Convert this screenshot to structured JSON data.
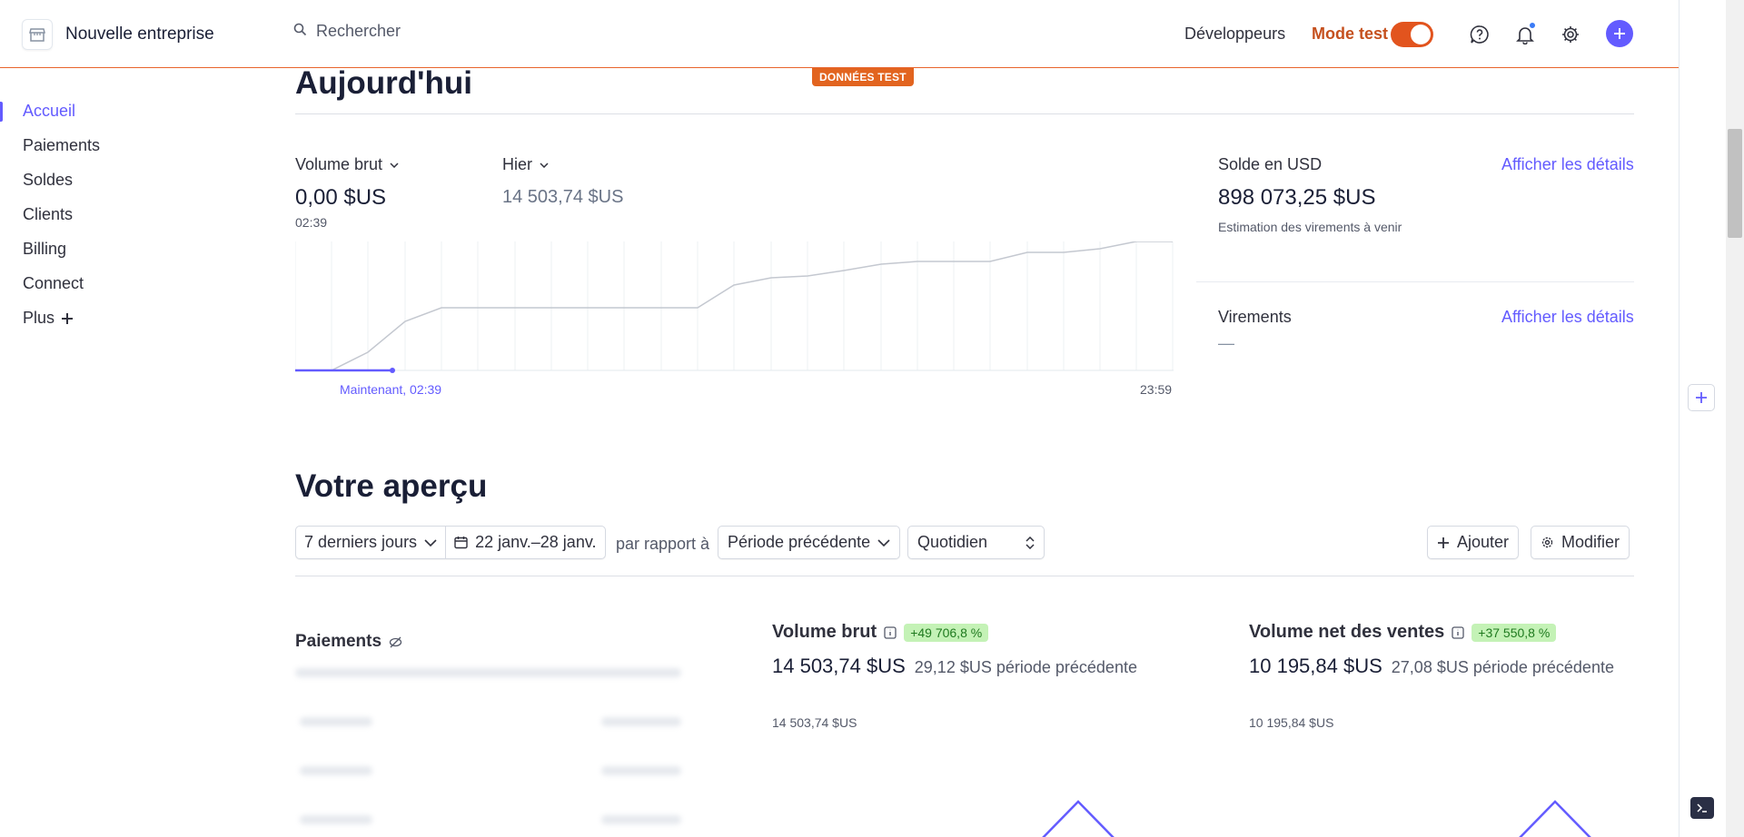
{
  "header": {
    "company_name": "Nouvelle entreprise",
    "search_placeholder": "Rechercher",
    "developers_label": "Développeurs",
    "test_mode_label": "Mode test",
    "test_mode_on": true,
    "test_data_badge": "DONNÉES TEST",
    "icons": [
      "store-icon",
      "search-icon",
      "help-icon",
      "bell-icon",
      "gear-icon",
      "plus-icon"
    ]
  },
  "sidebar": {
    "items": [
      {
        "label": "Accueil",
        "active": true
      },
      {
        "label": "Paiements"
      },
      {
        "label": "Soldes"
      },
      {
        "label": "Clients"
      },
      {
        "label": "Billing"
      },
      {
        "label": "Connect"
      },
      {
        "label": "Plus"
      }
    ]
  },
  "today": {
    "title": "Aujourd'hui",
    "gross_volume_label": "Volume brut",
    "gross_volume_value": "0,00 $US",
    "gross_volume_time": "02:39",
    "yesterday_label": "Hier",
    "yesterday_value": "14 503,74 $US",
    "now_label": "Maintenant, 02:39",
    "end_label": "23:59",
    "balance_label": "Solde en USD",
    "balance_value": "898 073,25 $US",
    "balance_note": "Estimation des virements à venir",
    "details_link_1": "Afficher les détails",
    "payouts_label": "Virements",
    "payouts_value": "—",
    "details_link_2": "Afficher les détails"
  },
  "overview": {
    "title": "Votre aperçu",
    "range_label": "7 derniers jours",
    "date_range": "22 janv.–28 janv.",
    "compare_label": "par rapport à",
    "compare_value": "Période précédente",
    "interval": "Quotidien",
    "add_label": "Ajouter",
    "edit_label": "Modifier",
    "payments_card_title": "Paiements",
    "gross_card": {
      "title": "Volume brut",
      "change": "+49 706,8 %",
      "value": "14 503,74 $US",
      "previous": "29,12 $US période précédente",
      "axis_label": "14 503,74 $US"
    },
    "net_card": {
      "title": "Volume net des ventes",
      "change": "+37 550,8 %",
      "value": "10 195,84 $US",
      "previous": "27,08 $US période précédente",
      "axis_label": "10 195,84 $US"
    }
  },
  "colors": {
    "accent": "#635bff",
    "test_orange": "#e2541e",
    "positive_badge": "#c4f2b6"
  }
}
